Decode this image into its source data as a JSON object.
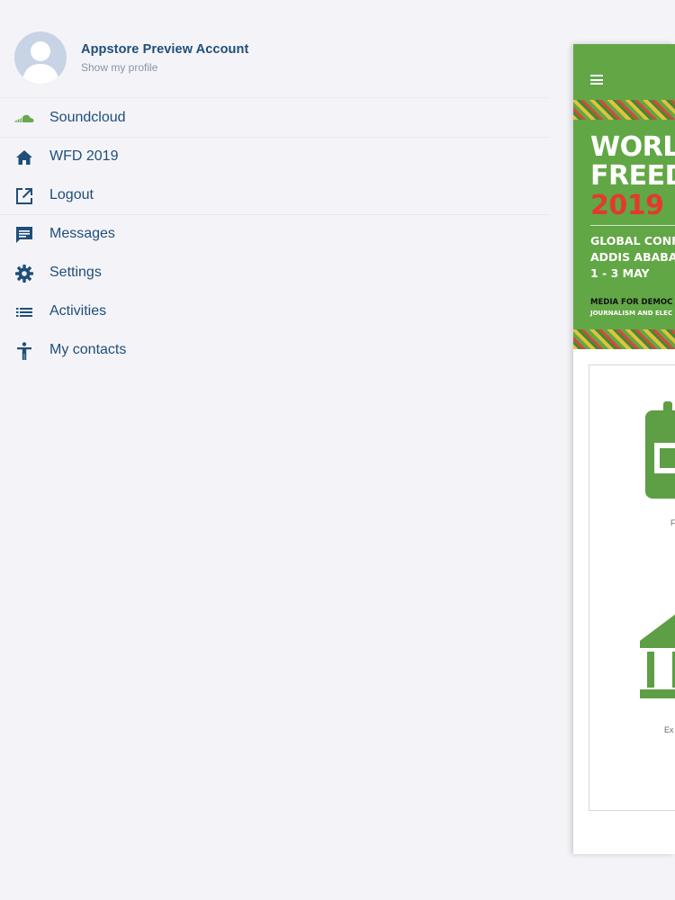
{
  "profile": {
    "name": "Appstore Preview Account",
    "subtitle": "Show my profile"
  },
  "menu": {
    "items": [
      {
        "label": "Soundcloud",
        "icon": "soundcloud-icon"
      },
      {
        "label": "WFD 2019",
        "icon": "home-icon"
      },
      {
        "label": "Logout",
        "icon": "external-link-icon"
      },
      {
        "label": "Messages",
        "icon": "message-icon"
      },
      {
        "label": "Settings",
        "icon": "gear-icon"
      },
      {
        "label": "Activities",
        "icon": "list-icon"
      },
      {
        "label": "My contacts",
        "icon": "accessibility-person-icon"
      }
    ]
  },
  "app_preview": {
    "banner": {
      "line1": "WORL",
      "line2": "FREED",
      "line3": "2019",
      "line4": "GLOBAL CONF",
      "line5": "ADDIS ABABA,",
      "line6": "1 - 3 MAY",
      "line7": "MEDIA FOR DEMOC",
      "line8": "JOURNALISM AND ELEC"
    },
    "tiles": [
      {
        "label": "F",
        "icon": "calendar-icon"
      },
      {
        "label": "Ex",
        "icon": "institution-icon"
      }
    ]
  },
  "colors": {
    "primary_text": "#1f4e79",
    "secondary_text": "#8b93a3",
    "soundcloud_green": "#6aa84f",
    "app_green": "#63a646",
    "banner_red": "#e23a2e",
    "background": "#f4f4f8"
  }
}
